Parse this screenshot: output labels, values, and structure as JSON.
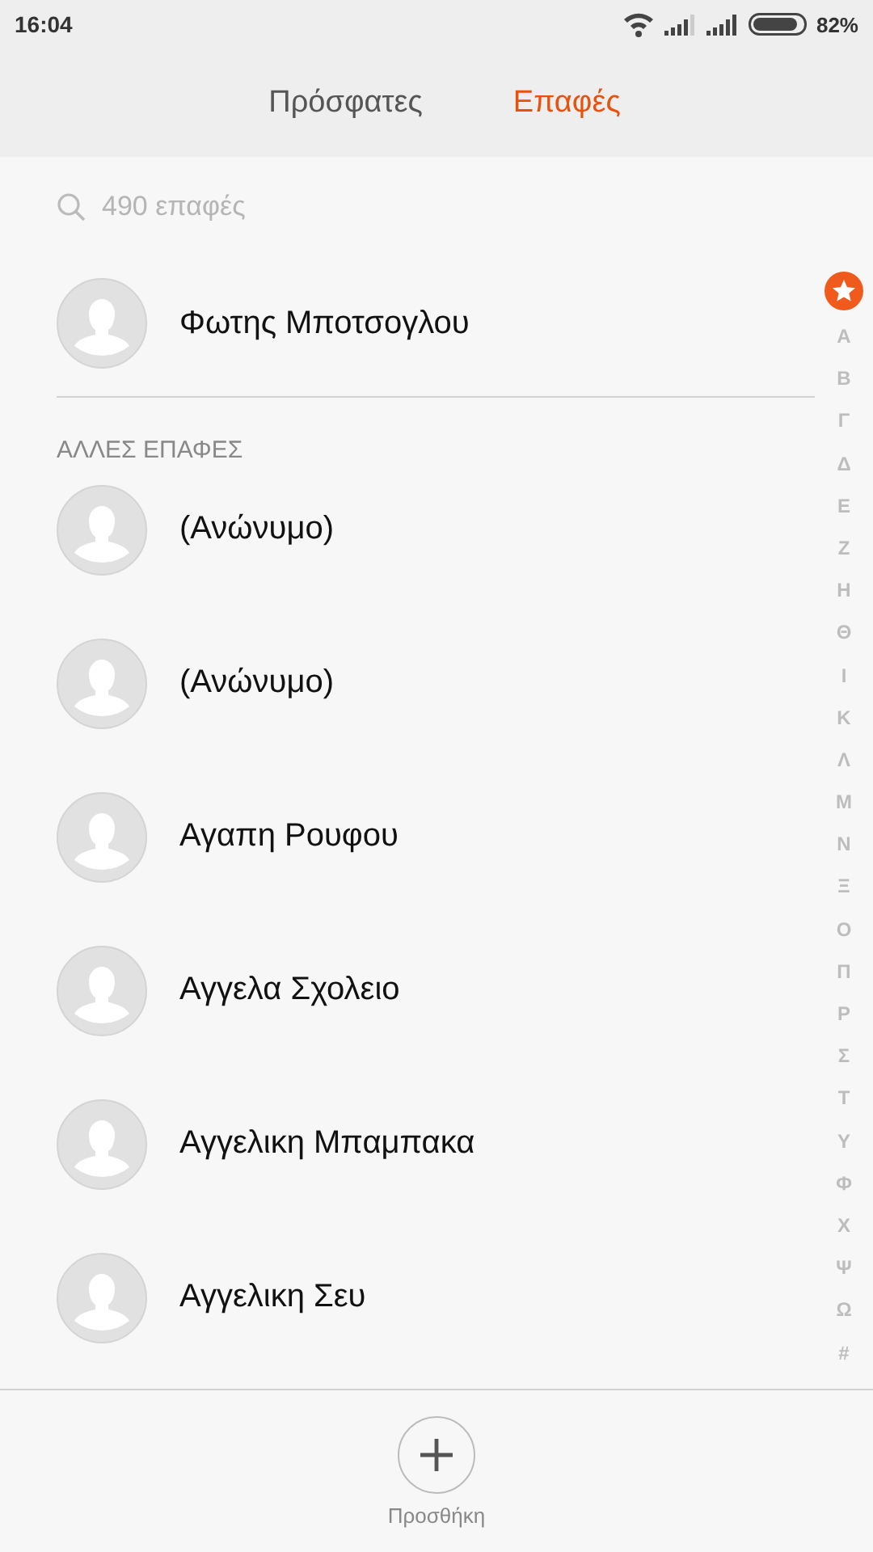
{
  "status_bar": {
    "time": "16:04",
    "battery": "82%"
  },
  "tabs": [
    {
      "label": "Πρόσφατες",
      "selected": false
    },
    {
      "label": "Επαφές",
      "selected": true
    }
  ],
  "search": {
    "placeholder": "490 επαφές"
  },
  "favorites": [
    {
      "name": "Φωτης Μποτσογλου"
    }
  ],
  "section": {
    "title": "ΑΛΛΕΣ ΕΠΑΦΕΣ",
    "contacts": [
      {
        "name": "(Ανώνυμο)"
      },
      {
        "name": "(Ανώνυμο)"
      },
      {
        "name": "Αγαπη Ρουφου"
      },
      {
        "name": "Αγγελα Σχολειο"
      },
      {
        "name": "Αγγελικη Μπαμπακα"
      },
      {
        "name": "Αγγελικη Σευ"
      }
    ]
  },
  "index": [
    "Α",
    "Β",
    "Γ",
    "Δ",
    "Ε",
    "Ζ",
    "Η",
    "Θ",
    "Ι",
    "Κ",
    "Λ",
    "Μ",
    "Ν",
    "Ξ",
    "Ο",
    "Π",
    "Ρ",
    "Σ",
    "Τ",
    "Υ",
    "Φ",
    "Χ",
    "Ψ",
    "Ω",
    "#"
  ],
  "add_button": {
    "label": "Προσθήκη"
  }
}
